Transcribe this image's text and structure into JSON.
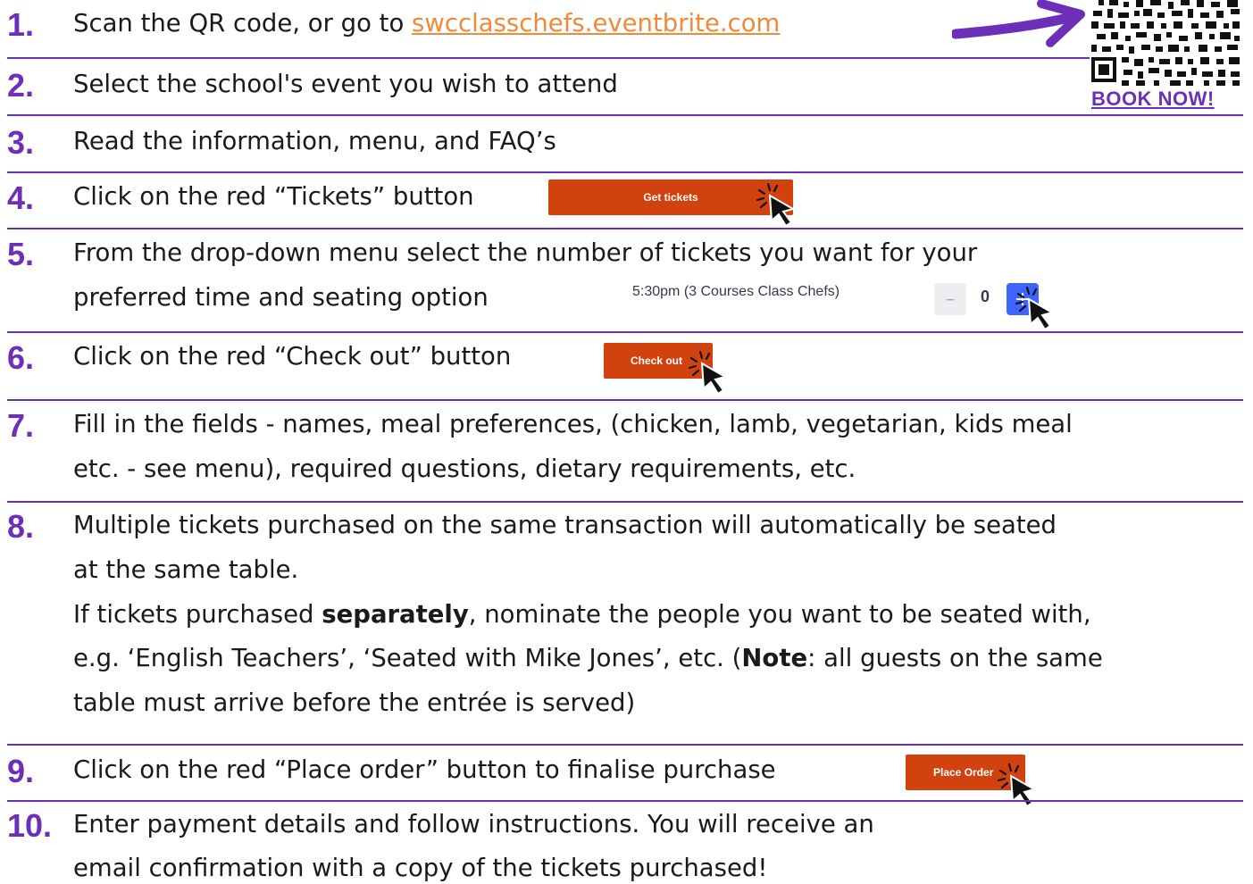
{
  "steps": [
    {
      "num": "1.",
      "text_before": "Scan the QR code, or go to ",
      "link": "swcclasschefs.eventbrite.com"
    },
    {
      "num": "2.",
      "text": "Select the school's event you wish to attend"
    },
    {
      "num": "3.",
      "text": "Read the information, menu, and FAQ’s"
    },
    {
      "num": "4.",
      "text": "Click on the red “Tickets” button",
      "button": "Get tickets"
    },
    {
      "num": "5.",
      "line1": "From the drop-down menu select the number of tickets you want for your",
      "line2": "preferred time and seating option",
      "ticket_time": "5:30pm (3 Courses Class Chefs)",
      "qty": "0",
      "minus": "–",
      "plus": "+"
    },
    {
      "num": "6.",
      "text": "Click on the red “Check out” button",
      "button": "Check out"
    },
    {
      "num": "7.",
      "line1": "Fill in the fields - names, meal preferences, (chicken, lamb, vegetarian, kids meal",
      "line2": "etc. - see menu), required questions, dietary requirements, etc."
    },
    {
      "num": "8.",
      "line1": "Multiple tickets purchased on the same transaction will automatically be seated",
      "line2": "at the same table.",
      "line3_before": "If tickets purchased ",
      "line3_bold": "separately",
      "line3_after": ", nominate the people you want to be seated with,",
      "line4_before": "e.g. ‘English Teachers’, ‘Seated with Mike Jones’, etc. (",
      "line4_bold": "Note",
      "line4_after": ": all guests on the same",
      "line5": "table must arrive before the entrée is served)"
    },
    {
      "num": "9.",
      "text": "Click on the red “Place order” button to finalise purchase",
      "button": "Place Order"
    },
    {
      "num": "10.",
      "line1": "Enter payment details and follow instructions. You will receive an",
      "line2": "email confirmation with a copy of the tickets purchased!"
    }
  ],
  "qr": {
    "label": "BOOK NOW!"
  },
  "colors": {
    "accent": "#6b2fb8",
    "link": "#f08a3a",
    "button": "#d2420f",
    "plus": "#3d64ff"
  }
}
